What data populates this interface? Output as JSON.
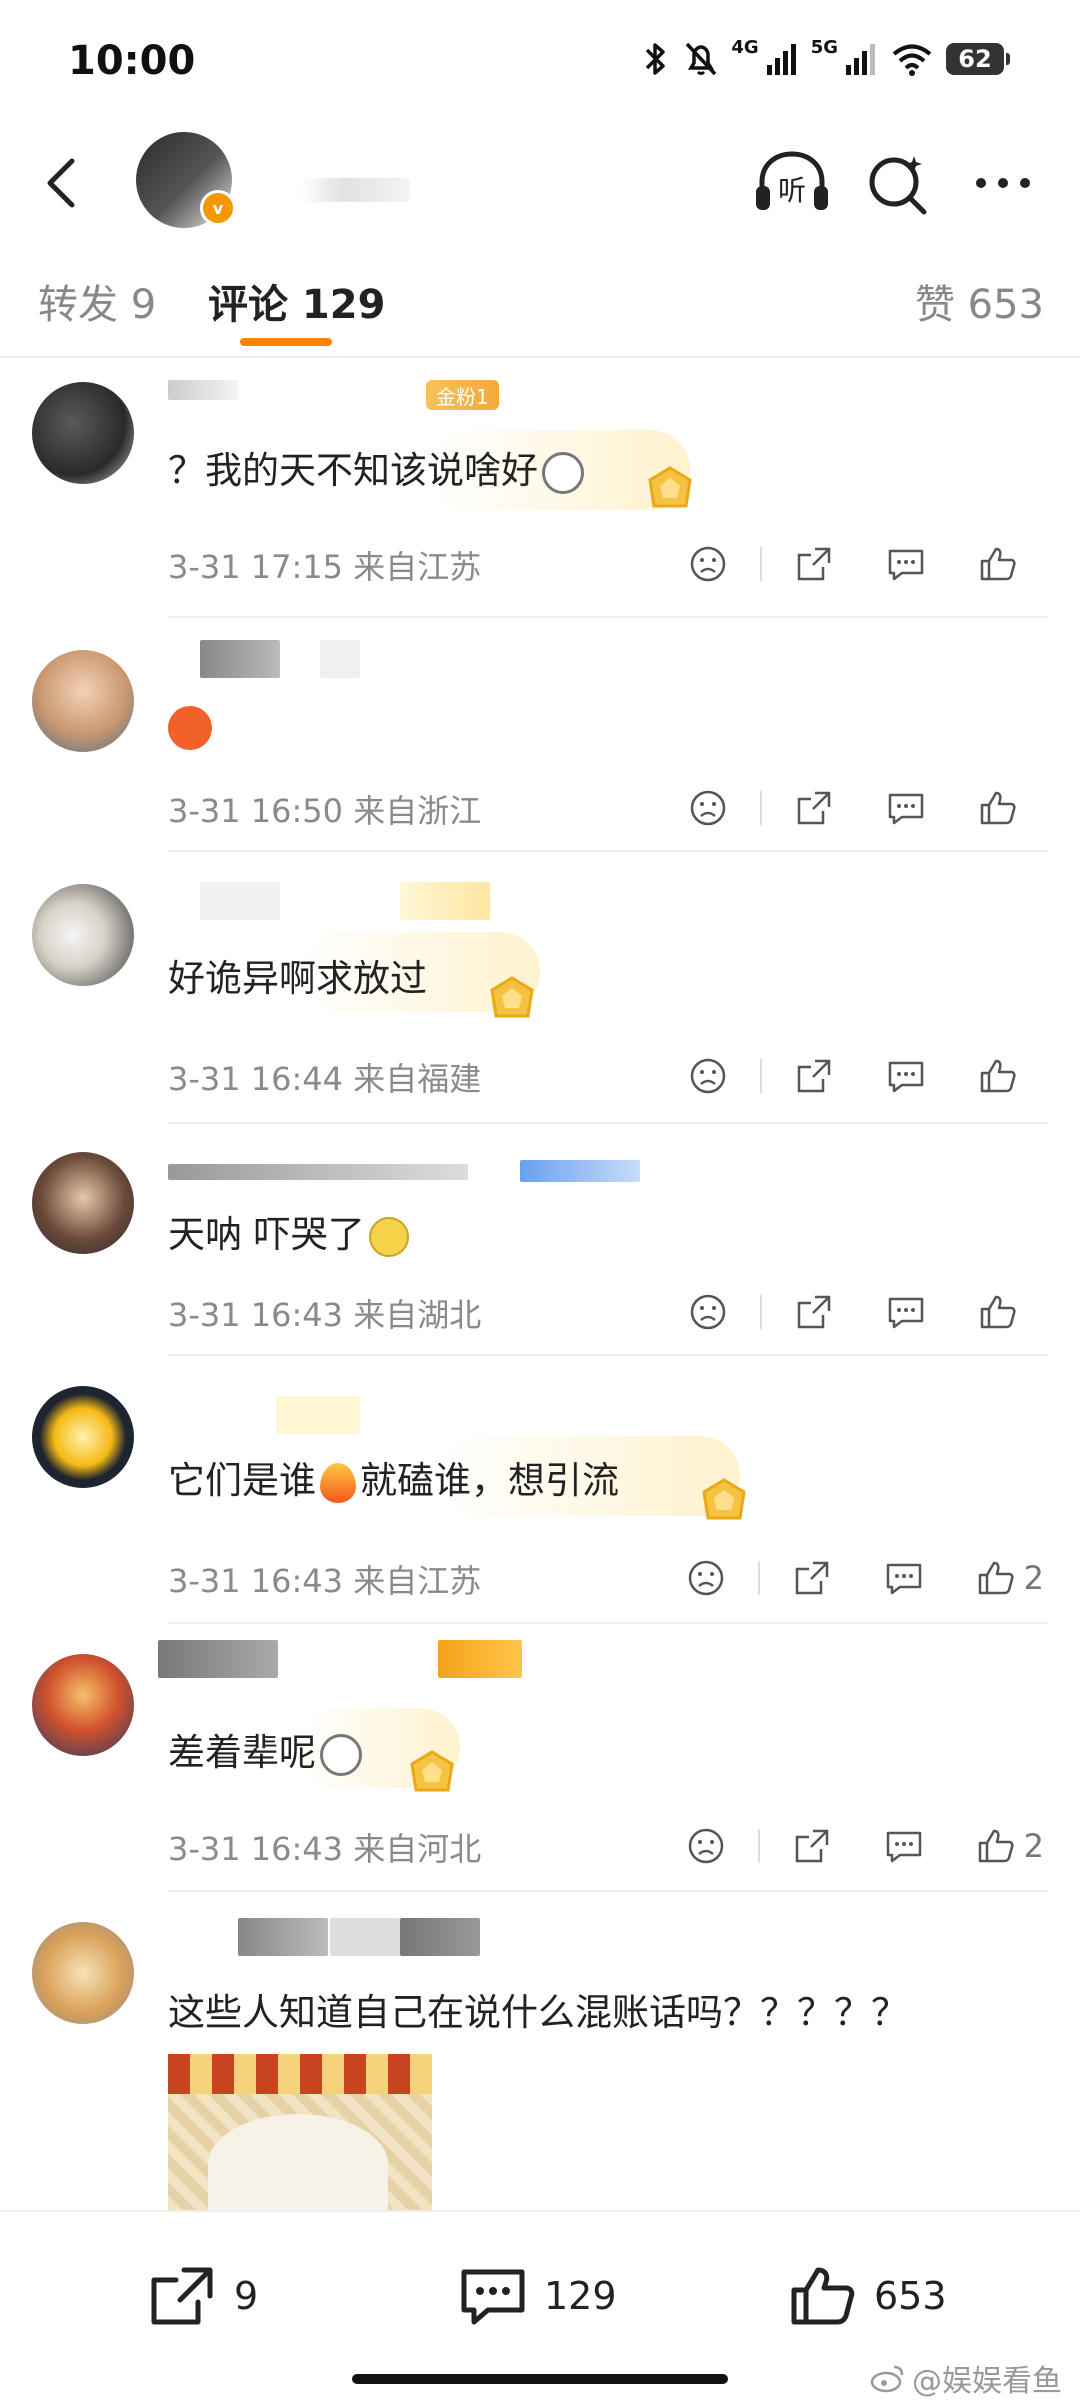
{
  "status": {
    "time": "10:00",
    "net1": "4G",
    "net2": "5G",
    "battery": "62"
  },
  "header": {
    "listen_label": "听"
  },
  "tabs": [
    {
      "label": "转发 9"
    },
    {
      "label": "评论 129"
    },
    {
      "label": "赞 653"
    }
  ],
  "comments": [
    {
      "text": "？我的天不知该说啥好",
      "meta": "3-31 17:15  来自江苏",
      "fan_badge": "金粉1",
      "likes": ""
    },
    {
      "text": "",
      "meta": "3-31 16:50  来自浙江",
      "likes": ""
    },
    {
      "text": "好诡异啊求放过",
      "meta": "3-31 16:44  来自福建",
      "likes": ""
    },
    {
      "text": "天呐 吓哭了",
      "meta": "3-31 16:43  来自湖北",
      "likes": ""
    },
    {
      "text_a": "它们是谁",
      "text_b": "就磕谁，想引流",
      "meta": "3-31 16:43  来自江苏",
      "likes": "2"
    },
    {
      "text": "差着辈呢",
      "meta": "3-31 16:43  来自河北",
      "likes": "2"
    },
    {
      "text": "这些人知道自己在说什么混账话吗？？？？？",
      "meta": "",
      "likes": ""
    }
  ],
  "bottom": {
    "repost_count": "9",
    "comment_count": "129",
    "like_count": "653"
  },
  "watermark": "@娱娱看鱼",
  "colors": {
    "accent": "#ff8200",
    "gold": "#f5c242",
    "meta": "#8a8a8a"
  }
}
